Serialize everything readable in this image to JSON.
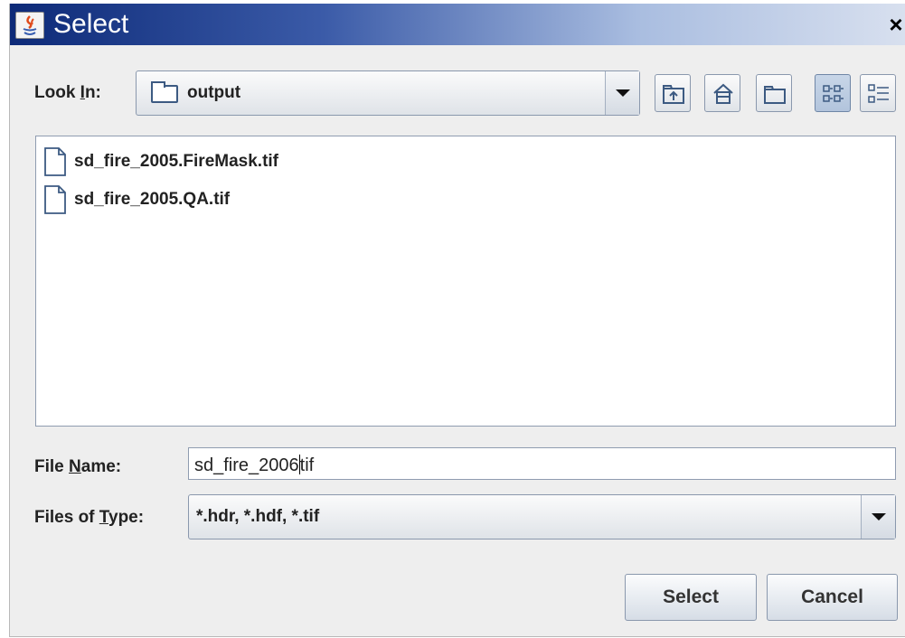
{
  "window": {
    "title": "Select",
    "close_glyph": "×"
  },
  "look_in": {
    "label_pre": "Look ",
    "label_mnemonic": "I",
    "label_post": "n:",
    "value": "output",
    "icon": "folder-icon"
  },
  "toolbar": [
    {
      "name": "up-one-level-button",
      "icon": "up-folder-icon",
      "active": false
    },
    {
      "name": "home-button",
      "icon": "home-icon",
      "active": false
    },
    {
      "name": "create-new-folder-button",
      "icon": "new-folder-icon",
      "active": false
    },
    {
      "name": "list-view-button",
      "icon": "list-view-icon",
      "active": true
    },
    {
      "name": "details-view-button",
      "icon": "details-view-icon",
      "active": false
    }
  ],
  "files": [
    {
      "name": "sd_fire_2005.FireMask.tif",
      "icon": "file-icon"
    },
    {
      "name": "sd_fire_2005.QA.tif",
      "icon": "file-icon"
    }
  ],
  "file_name": {
    "label_pre": "File ",
    "label_mnemonic": "N",
    "label_post": "ame:",
    "value_before_caret": "sd_fire_2006",
    "value_after_caret": "tif"
  },
  "file_type": {
    "label_pre": "Files of ",
    "label_mnemonic": "T",
    "label_post": "ype:",
    "value": "*.hdr, *.hdf, *.tif"
  },
  "buttons": {
    "select": "Select",
    "cancel": "Cancel"
  },
  "colors": {
    "title_gradient_start": "#0d2a78",
    "title_gradient_end": "#d8e0ef",
    "dialog_bg": "#eeeeee"
  }
}
